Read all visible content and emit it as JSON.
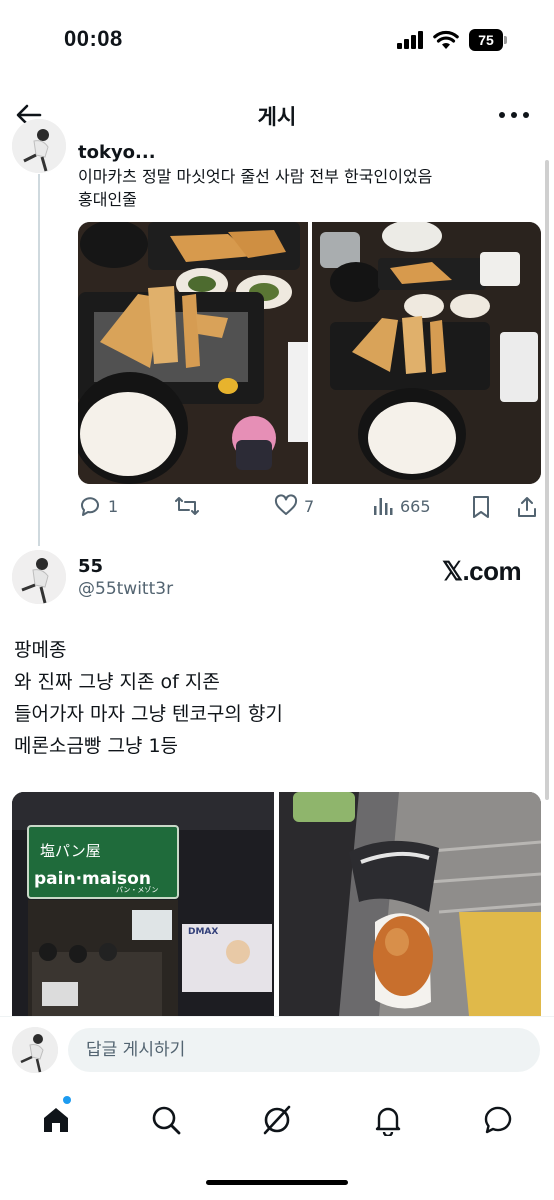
{
  "status_bar": {
    "time": "00:08",
    "battery": "75",
    "icons": [
      "signal-icon",
      "wifi-icon",
      "battery-icon"
    ]
  },
  "header": {
    "title": "게시",
    "back_icon": "arrow-left-icon",
    "more_icon": "more-horizontal-icon"
  },
  "reply_post": {
    "name": "tokyo...",
    "text_lines": [
      "이마카츠 정말 마싯엇다 줄선 사람 전부 한국인이었음",
      "홍대인줄"
    ],
    "images": [
      "tonkatsu-set-photo-1",
      "tonkatsu-set-photo-2"
    ],
    "actions": {
      "replies": "1",
      "reposts": "",
      "likes": "7",
      "views": "665"
    }
  },
  "main_post": {
    "name": "55",
    "handle": "@55twitt3r",
    "source_label": "𝕏.com",
    "text_lines": [
      "팡메종",
      "와 진짜 그냥 지존 of 지존",
      "들어가자 마자 그냥 텐코구의 향기",
      "메론소금빵 그냥 1등"
    ],
    "images": [
      {
        "sign_text": "塩パン屋",
        "sign_brand": "pain·maison",
        "sign_sub": "パン・メゾン",
        "billboard": "DMAX"
      },
      {
        "subject": "salt-bread-photo"
      }
    ]
  },
  "composer": {
    "placeholder": "답글 게시하기"
  },
  "tab_bar": {
    "items": [
      "home-icon",
      "search-icon",
      "grok-icon",
      "notifications-icon",
      "messages-icon"
    ],
    "active": "home-icon"
  },
  "colors": {
    "accent": "#1d9bf0",
    "secondary_text": "#536471",
    "divider": "#cfd9de",
    "sign_green": "#1f6b3b"
  }
}
